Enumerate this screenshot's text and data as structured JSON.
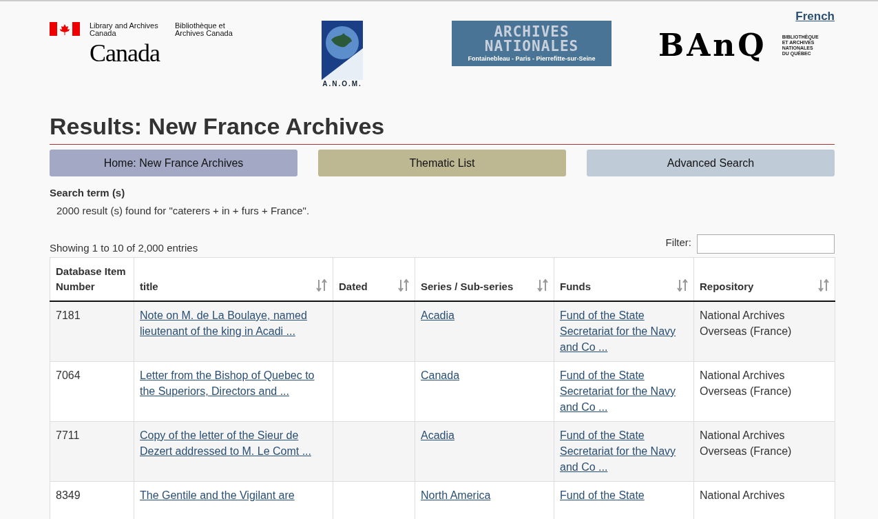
{
  "language_link": "French",
  "logos": {
    "lac": {
      "english": "Library and Archives Canada",
      "french": "Bibliothèque et Archives Canada",
      "wordmark": "Canada"
    },
    "anom": {
      "caption": "A.N.O.M."
    },
    "an": {
      "line1": "ARCHIVES",
      "line2": "NATIONALES",
      "places": "Fontainebleau - Paris - Pierrefitte-sur-Seine"
    },
    "banq": {
      "mark": "BAnQ",
      "line1": "BIBLIOTHÈQUE",
      "line2": "ET ARCHIVES",
      "line3": "NATIONALES",
      "line4": "DU QUÉBEC"
    }
  },
  "title": "Results: New France Archives",
  "nav_buttons": [
    {
      "label": "Home: New France Archives",
      "color": "#a3a9c4"
    },
    {
      "label": "Thematic List",
      "color": "#bdb892"
    },
    {
      "label": "Advanced Search",
      "color": "#bfccd7"
    }
  ],
  "search": {
    "heading": "Search term (s)",
    "summary": "2000 result (s) found for \"caterers + in + furs + France\"."
  },
  "table_info": "Showing 1 to 10 of 2,000 entries",
  "filter": {
    "label": "Filter:"
  },
  "table": {
    "columns": [
      {
        "label": "Database Item Number",
        "sortable": false
      },
      {
        "label": "title",
        "sortable": true
      },
      {
        "label": "Dated",
        "sortable": true
      },
      {
        "label": "Series / Sub-series",
        "sortable": true
      },
      {
        "label": "Funds",
        "sortable": true
      },
      {
        "label": "Repository",
        "sortable": true
      }
    ],
    "rows": [
      {
        "number": "7181",
        "title": [
          "Note on M. de La Boulaye, named",
          "lieutenant of the king in Acadi ..."
        ],
        "dated": "",
        "series": "Acadia",
        "funds": [
          "Fund of the State",
          "Secretariat for the Navy",
          "and Co ..."
        ],
        "repository": [
          "National Archives",
          "Overseas (France)"
        ]
      },
      {
        "number": "7064",
        "title": [
          "Letter from the Bishop of Quebec to",
          "the Superiors, Directors and ..."
        ],
        "dated": "",
        "series": "Canada",
        "funds": [
          "Fund of the State",
          "Secretariat for the Navy",
          "and Co ..."
        ],
        "repository": [
          "National Archives",
          "Overseas (France)"
        ]
      },
      {
        "number": "7711",
        "title": [
          "Copy of the letter of the Sieur de",
          "Dezert addressed to M. Le Comt ..."
        ],
        "dated": "",
        "series": "Acadia",
        "funds": [
          "Fund of the State",
          "Secretariat for the Navy",
          "and Co ..."
        ],
        "repository": [
          "National Archives",
          "Overseas (France)"
        ]
      },
      {
        "number": "8349",
        "title": [
          "The Gentile and the Vigilant are"
        ],
        "dated": "",
        "series": "North America",
        "funds": [
          "Fund of the State"
        ],
        "repository": [
          "National Archives"
        ]
      }
    ]
  }
}
